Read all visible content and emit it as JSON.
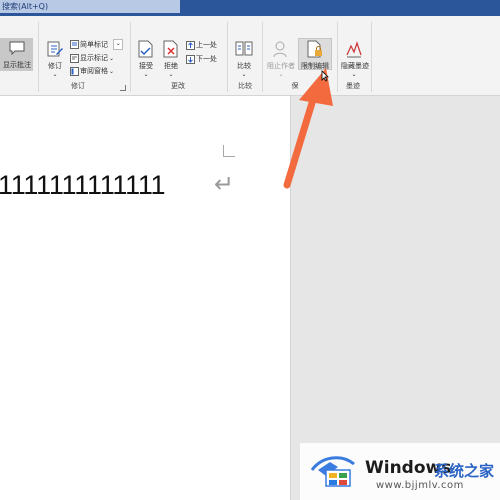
{
  "title_bar": {
    "search_text": "搜索(Alt+Q)"
  },
  "ribbon": {
    "comments": {
      "show_comments_label": "显示批注"
    },
    "tracking": {
      "track_changes_label": "修订",
      "markup_mode_value": "简单标记",
      "show_markup_label": "显示标记",
      "reviewing_pane_label": "审阅窗格",
      "group_label": "修订"
    },
    "changes": {
      "accept_label": "接受",
      "reject_label": "拒绝",
      "previous_label": "上一处",
      "next_label": "下一处",
      "group_label": "更改"
    },
    "compare": {
      "compare_label": "比较",
      "group_label": "比较"
    },
    "protect": {
      "block_authors_label": "阻止作者",
      "restrict_editing_label": "限制编辑",
      "group_label": "保"
    },
    "ink": {
      "hide_ink_label": "隐藏墨迹",
      "group_label": "墨迹"
    }
  },
  "document": {
    "text": "1111111111111",
    "paragraph_mark": "↵"
  },
  "watermark": {
    "brand": "Windows",
    "cn_text": "系统之家",
    "url": "www.bjjmlv.com"
  },
  "colors": {
    "titlebar": "#2b579a",
    "arrow": "#f26a3d",
    "accent": "#2a63c4"
  }
}
